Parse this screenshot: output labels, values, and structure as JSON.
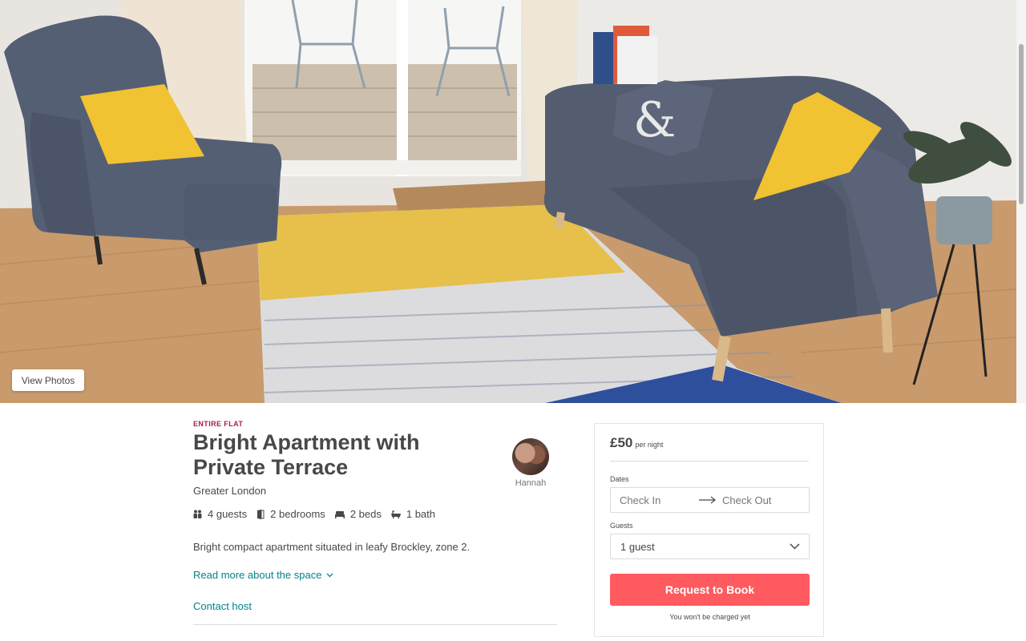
{
  "hero": {
    "view_photos_label": "View Photos"
  },
  "listing": {
    "room_type": "Entire Flat",
    "title": "Bright Apartment with Private Terrace",
    "location": "Greater London",
    "host_name": "Hannah",
    "amenities": [
      {
        "icon": "guests-icon",
        "label": "4 guests"
      },
      {
        "icon": "bedroom-door-icon",
        "label": "2 bedrooms"
      },
      {
        "icon": "bed-icon",
        "label": "2 beds"
      },
      {
        "icon": "bathtub-icon",
        "label": "1 bath"
      }
    ],
    "summary": "Bright compact apartment situated in leafy Brockley, zone 2.",
    "read_more_label": "Read more about the space",
    "contact_label": "Contact host"
  },
  "booking": {
    "price": "£50",
    "per_night": "per night",
    "dates_label": "Dates",
    "check_in_placeholder": "Check In",
    "check_out_placeholder": "Check Out",
    "guests_label": "Guests",
    "guests_value": "1 guest",
    "book_button": "Request to Book",
    "no_charge_note": "You won't be charged yet"
  },
  "colors": {
    "brand": "#ff5a5f",
    "link": "#008489",
    "room_type": "#a61d55"
  }
}
